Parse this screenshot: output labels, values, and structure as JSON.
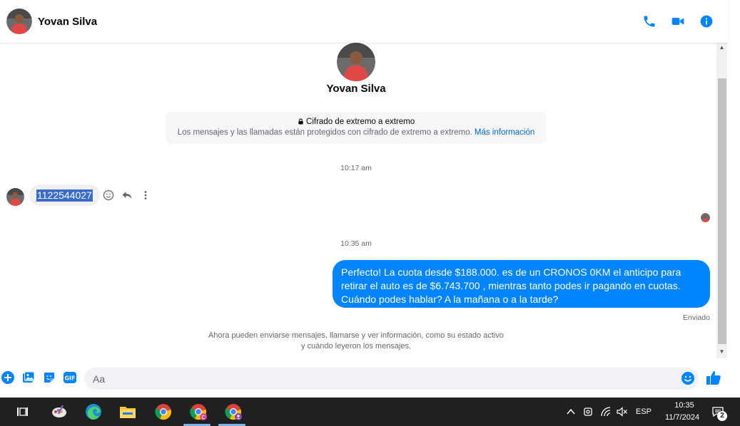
{
  "header": {
    "contact_name": "Yovan Silva"
  },
  "profile": {
    "name": "Yovan Silva"
  },
  "encryption": {
    "title": "Cifrado de extremo a extremo",
    "description": "Los mensajes y las llamadas están protegidos con cifrado de extremo a extremo.",
    "link": "Más información"
  },
  "messages": [
    {
      "timestamp": "10:17 am",
      "from": "peer",
      "text": "1122544027"
    },
    {
      "timestamp": "10:35 am",
      "from": "me",
      "text": "Perfecto! La cuota desde $188.000. es de un CRONOS 0KM el anticipo para retirar el auto es de $6.743.700 , mientras tanto podes ir pagando en cuotas. Cuándo podes hablar? A la mañana o a la tarde?",
      "status": "Enviado"
    }
  ],
  "info_text_line1": "Ahora pueden enviarse mensajes, llamarse y ver información, como su estado activo",
  "info_text_line2": "y cuándo leyeron los mensajes.",
  "composer": {
    "placeholder": "Aa"
  },
  "taskbar": {
    "language": "ESP",
    "time": "10:35",
    "date": "11/7/2024",
    "notification_count": "2"
  },
  "colors": {
    "accent": "#0084ff",
    "link": "#0064d1",
    "taskbar": "#202020"
  }
}
